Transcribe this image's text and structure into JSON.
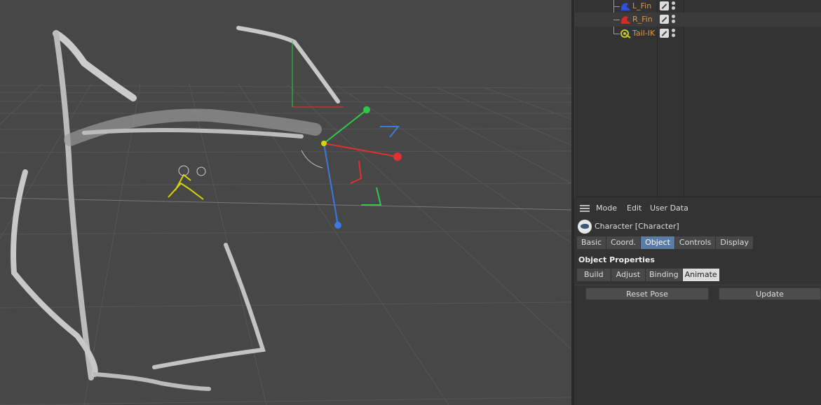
{
  "object_manager": {
    "rows": [
      {
        "label": "L_Fin",
        "label_color": "#e0963a",
        "icon": "blue-fin-icon",
        "icon_color": "#2f50d8"
      },
      {
        "label": "R_Fin",
        "label_color": "#e0963a",
        "icon": "red-fin-icon",
        "icon_color": "#d52a2a"
      },
      {
        "label": "Tail-IK",
        "label_color": "#e0963a",
        "icon": "ik-tag-icon",
        "icon_color": "#c8c820"
      }
    ]
  },
  "attribute_manager": {
    "menu": [
      "Mode",
      "Edit",
      "User Data"
    ],
    "object_title": "Character [Character]",
    "object_tabs": [
      "Basic",
      "Coord.",
      "Object",
      "Controls",
      "Display"
    ],
    "active_object_tab": "Object",
    "section_title": "Object Properties",
    "mode_tabs": [
      "Build",
      "Adjust",
      "Binding",
      "Animate"
    ],
    "active_mode_tab": "Animate",
    "buttons": {
      "reset_pose": "Reset Pose",
      "update": "Update"
    }
  },
  "viewport": {
    "background": "#474747",
    "axis_colors": {
      "x": "#e03030",
      "y": "#2fc84a",
      "z": "#3a7be0"
    }
  }
}
